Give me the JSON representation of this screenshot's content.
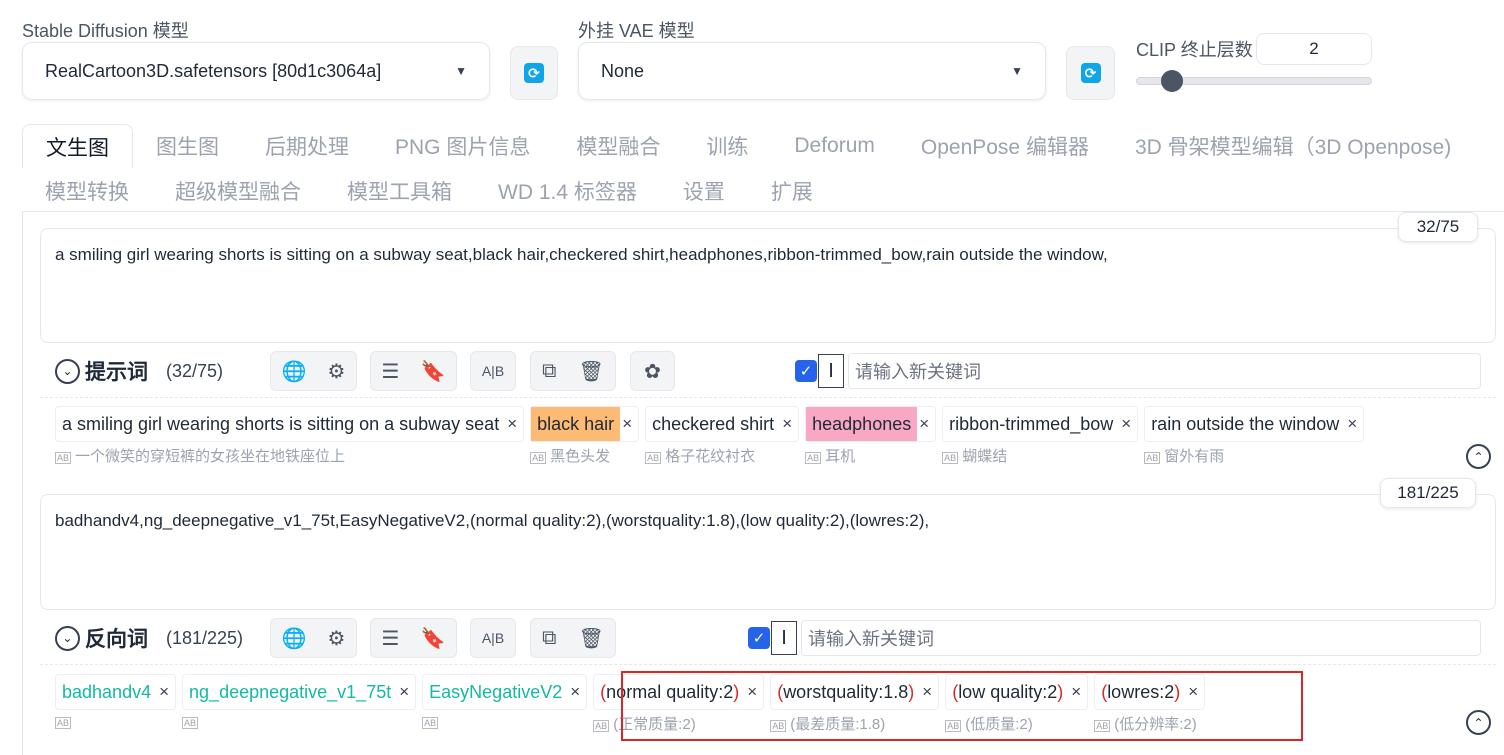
{
  "sd_model": {
    "label": "Stable Diffusion 模型",
    "value": "RealCartoon3D.safetensors [80d1c3064a]"
  },
  "vae": {
    "label": "外挂 VAE 模型",
    "value": "None"
  },
  "clip": {
    "label": "CLIP 终止层数",
    "value": "2",
    "slider_fraction": 0.1
  },
  "tabs_row1": [
    "文生图",
    "图生图",
    "后期处理",
    "PNG 图片信息",
    "模型融合",
    "训练",
    "Deforum",
    "OpenPose 编辑器",
    "3D 骨架模型编辑（3D Openpose)"
  ],
  "tabs_row2": [
    "模型转换",
    "超级模型融合",
    "模型工具箱",
    "WD 1.4 标签器",
    "设置",
    "扩展"
  ],
  "prompt": {
    "text": "a smiling girl wearing shorts is sitting on a subway seat,black hair,checkered shirt,headphones,ribbon-trimmed_bow,rain outside the window,",
    "counter": "32/75",
    "title": "提示词",
    "count": "(32/75)",
    "keyword_placeholder": "请输入新关键词",
    "tags": [
      {
        "text": "a smiling girl wearing shorts is sitting on a subway seat",
        "tr": "一个微笑的穿短裤的女孩坐在地铁座位上",
        "bg": ""
      },
      {
        "text": "black hair",
        "tr": "黑色头发",
        "bg": "#fdba74"
      },
      {
        "text": "checkered shirt",
        "tr": "格子花纹衬衣",
        "bg": ""
      },
      {
        "text": "headphones",
        "tr": "耳机",
        "bg": "#f9a8c4"
      },
      {
        "text": "ribbon-trimmed_bow",
        "tr": "蝴蝶结",
        "bg": ""
      },
      {
        "text": "rain outside the window",
        "tr": "窗外有雨",
        "bg": ""
      }
    ]
  },
  "negative": {
    "text": "badhandv4,ng_deepnegative_v1_75t,EasyNegativeV2,(normal quality:2),(worstquality:1.8),(low quality:2),(lowres:2),",
    "counter": "181/225",
    "title": "反向词",
    "count": "(181/225)",
    "keyword_placeholder": "请输入新关键词",
    "tags": [
      {
        "text": "badhandv4",
        "tr": "",
        "style": "teal"
      },
      {
        "text": "ng_deepnegative_v1_75t",
        "tr": "",
        "style": "teal"
      },
      {
        "text": "EasyNegativeV2",
        "tr": "",
        "style": "teal"
      },
      {
        "text": "normal quality:2",
        "tr": "(正常质量:2)",
        "style": "paren"
      },
      {
        "text": "worstquality:1.8",
        "tr": "(最差质量:1.8)",
        "style": "paren"
      },
      {
        "text": "low quality:2",
        "tr": "(低质量:2)",
        "style": "paren"
      },
      {
        "text": "lowres:2",
        "tr": "(低分辨率:2)",
        "style": "paren"
      }
    ]
  },
  "colors": {
    "accent": "#2563eb",
    "refresh": "#0ea5e9",
    "highlight_box": "#dc2626"
  }
}
